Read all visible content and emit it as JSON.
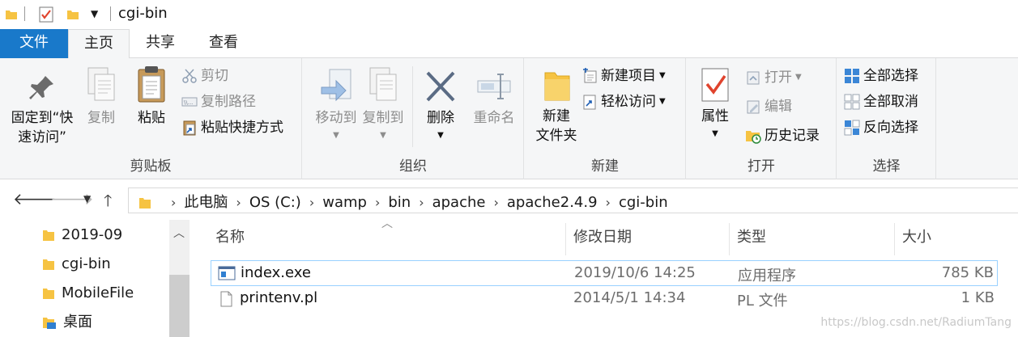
{
  "window": {
    "title": "cgi-bin"
  },
  "tabs": {
    "file": "文件",
    "home": "主页",
    "share": "共享",
    "view": "查看"
  },
  "ribbon": {
    "clipboard": {
      "label": "剪贴板",
      "pin_line1": "固定到“快",
      "pin_line2": "速访问”",
      "copy": "复制",
      "paste": "粘贴",
      "cut": "剪切",
      "copy_path": "复制路径",
      "paste_shortcut": "粘贴快捷方式"
    },
    "organize": {
      "label": "组织",
      "move_to": "移动到",
      "copy_to": "复制到",
      "delete": "删除",
      "rename": "重命名"
    },
    "new": {
      "label": "新建",
      "new_folder_line1": "新建",
      "new_folder_line2": "文件夹",
      "new_item": "新建项目",
      "easy_access": "轻松访问"
    },
    "open": {
      "label": "打开",
      "properties": "属性",
      "open": "打开",
      "edit": "编辑",
      "history": "历史记录"
    },
    "select": {
      "label": "选择",
      "select_all": "全部选择",
      "select_none": "全部取消",
      "invert": "反向选择"
    }
  },
  "address": {
    "crumbs": [
      "此电脑",
      "OS (C:)",
      "wamp",
      "bin",
      "apache",
      "apache2.4.9",
      "cgi-bin"
    ]
  },
  "navpane": {
    "items": [
      "2019-09",
      "cgi-bin",
      "MobileFile",
      "桌面"
    ]
  },
  "filelist": {
    "columns": {
      "name": "名称",
      "date": "修改日期",
      "type": "类型",
      "size": "大小"
    },
    "rows": [
      {
        "name": "index.exe",
        "date": "2019/10/6 14:25",
        "type": "应用程序",
        "size": "785 KB"
      },
      {
        "name": "printenv.pl",
        "date": "2014/5/1 14:34",
        "type": "PL 文件",
        "size": "1 KB"
      }
    ]
  },
  "watermark": "https://blog.csdn.net/RadiumTang",
  "colors": {
    "accent": "#1979ca",
    "folder": "#f6c342",
    "selection_border": "#99d1ff"
  }
}
